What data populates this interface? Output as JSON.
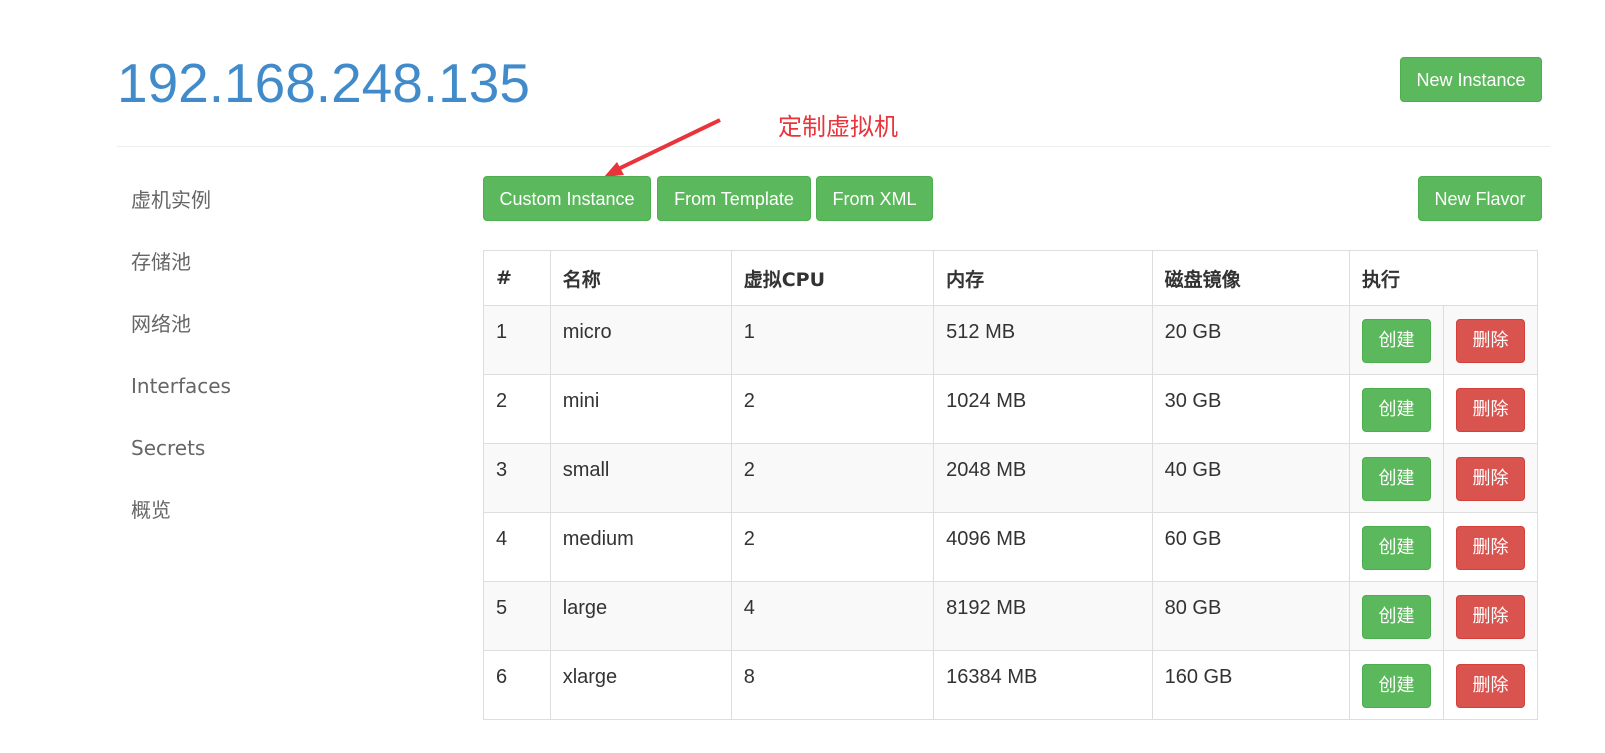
{
  "header": {
    "host": "192.168.248.135",
    "new_instance_label": "New Instance"
  },
  "annotation": {
    "text": "定制虚拟机",
    "color": "#e8343a"
  },
  "sidebar": {
    "items": [
      {
        "label": "虚机实例"
      },
      {
        "label": "存储池"
      },
      {
        "label": "网络池"
      },
      {
        "label": "Interfaces"
      },
      {
        "label": "Secrets"
      },
      {
        "label": "概览"
      }
    ]
  },
  "toolbar": {
    "custom_instance_label": "Custom Instance",
    "from_template_label": "From Template",
    "from_xml_label": "From XML",
    "new_flavor_label": "New Flavor"
  },
  "table": {
    "headers": [
      "#",
      "名称",
      "虚拟CPU",
      "内存",
      "磁盘镜像",
      "执行"
    ],
    "create_label": "创建",
    "delete_label": "删除",
    "rows": [
      {
        "id": "1",
        "name": "micro",
        "vcpu": "1",
        "memory": "512 MB",
        "disk": "20 GB"
      },
      {
        "id": "2",
        "name": "mini",
        "vcpu": "2",
        "memory": "1024 MB",
        "disk": "30 GB"
      },
      {
        "id": "3",
        "name": "small",
        "vcpu": "2",
        "memory": "2048 MB",
        "disk": "40 GB"
      },
      {
        "id": "4",
        "name": "medium",
        "vcpu": "2",
        "memory": "4096 MB",
        "disk": "60 GB"
      },
      {
        "id": "5",
        "name": "large",
        "vcpu": "4",
        "memory": "8192 MB",
        "disk": "80 GB"
      },
      {
        "id": "6",
        "name": "xlarge",
        "vcpu": "8",
        "memory": "16384 MB",
        "disk": "160 GB"
      }
    ]
  },
  "colors": {
    "accent": "#428bca",
    "success": "#5cb85c",
    "danger": "#d9534f"
  }
}
